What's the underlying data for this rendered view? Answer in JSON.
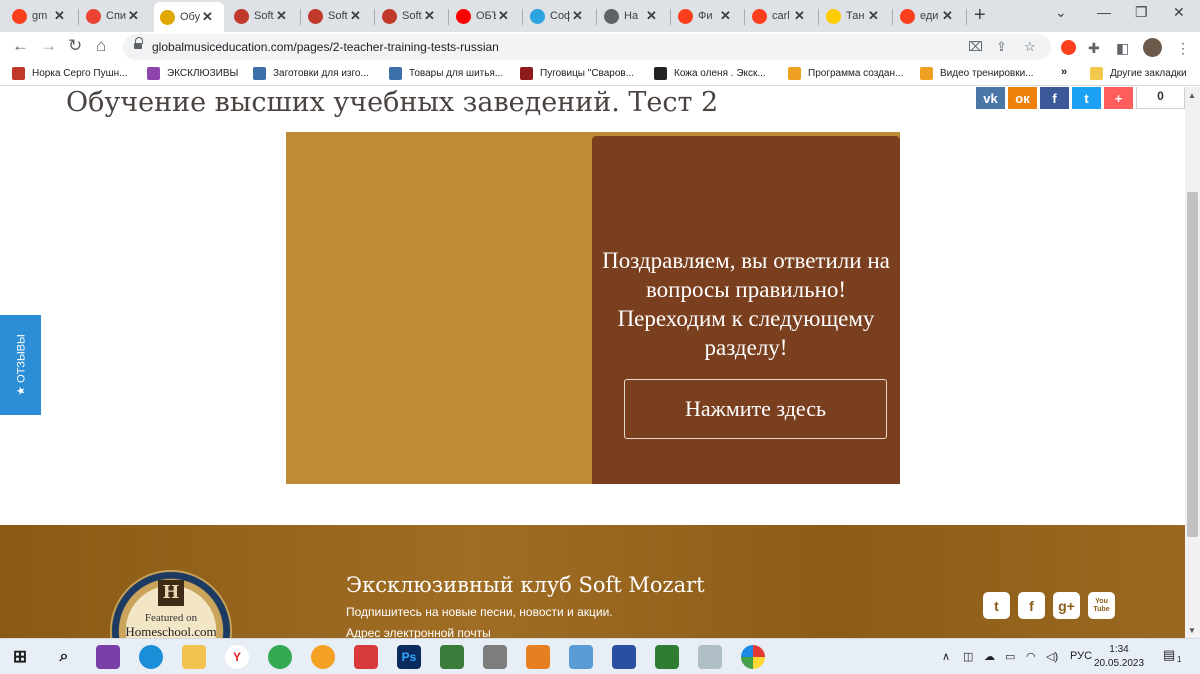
{
  "browser": {
    "tabs": [
      {
        "favicon": "yandex-icon",
        "label": "gm",
        "color": "#fc3f1d",
        "active": false
      },
      {
        "favicon": "gmail-icon",
        "label": "Спи",
        "color": "#ea4335",
        "active": false
      },
      {
        "favicon": "heart-icon",
        "label": "Обу",
        "color": "#e0a800",
        "active": true
      },
      {
        "favicon": "butterfly-icon",
        "label": "Soft",
        "color": "#c0392b",
        "active": false
      },
      {
        "favicon": "butterfly-icon",
        "label": "Soft",
        "color": "#c0392b",
        "active": false
      },
      {
        "favicon": "butterfly-icon",
        "label": "Soft",
        "color": "#c0392b",
        "active": false
      },
      {
        "favicon": "youtube-icon",
        "label": "ОБЪ",
        "color": "#ff0000",
        "active": false
      },
      {
        "favicon": "telegram-icon",
        "label": "Соф",
        "color": "#2aa3df",
        "active": false
      },
      {
        "favicon": "globe-icon",
        "label": "На",
        "color": "#5f6368",
        "active": false
      },
      {
        "favicon": "yandex-icon",
        "label": "Фи",
        "color": "#fc3f1d",
        "active": false
      },
      {
        "favicon": "yandex-icon",
        "label": "carl",
        "color": "#fc3f1d",
        "active": false
      },
      {
        "favicon": "play-icon",
        "label": "Тан",
        "color": "#ffcc00",
        "active": false
      },
      {
        "favicon": "yandex-icon",
        "label": "еди",
        "color": "#fc3f1d",
        "active": false
      }
    ],
    "tab_close": "✕",
    "new_tab": "+",
    "url": "globalmusiceducation.com/pages/2-teacher-training-tests-russian",
    "bookmarks": [
      {
        "label": "Норка Серго Пушн...",
        "icon": "color-square-icon",
        "color": "#c0392b"
      },
      {
        "label": "ЭКСКЛЮЗИВЫ",
        "icon": "butterfly-icon",
        "color": "#8e44ad"
      },
      {
        "label": "Заготовки для изго...",
        "icon": "b-letter-icon",
        "color": "#3d6fa8"
      },
      {
        "label": "Товары для шитья...",
        "icon": "b-letter-icon",
        "color": "#3d6fa8"
      },
      {
        "label": "Пуговицы \"Сваров...",
        "icon": "button-icon",
        "color": "#8e1b1b"
      },
      {
        "label": "Кожа оленя . Экск...",
        "icon": "x-logo-icon",
        "color": "#222222"
      },
      {
        "label": "Программа создан...",
        "icon": "ib-icon",
        "color": "#f0a020"
      },
      {
        "label": "Видео тренировки...",
        "icon": "ib-icon",
        "color": "#f0a020"
      }
    ],
    "bookmarks_more": "»",
    "other_bookmarks": "Другие закладки"
  },
  "page": {
    "title": "Обучение высших учебных заведений. Тест 2",
    "share_count": "0",
    "share_buttons": [
      {
        "name": "vk",
        "glyph": "vk",
        "color": "#4a76a8"
      },
      {
        "name": "odnoklassniki",
        "glyph": "ок",
        "color": "#ee8208"
      },
      {
        "name": "facebook",
        "glyph": "f",
        "color": "#3b5998"
      },
      {
        "name": "twitter",
        "glyph": "t",
        "color": "#1da1f2"
      },
      {
        "name": "plus",
        "glyph": "+",
        "color": "#ff5c5c"
      }
    ],
    "quiz_message": "Поздравляем, вы ответили на вопросы правильно! Переходим к следующему разделу!",
    "quiz_button": "Нажмите здесь",
    "feedback_tab": "★ ОТЗЫВЫ",
    "footer": {
      "badge_line1": "Featured on",
      "badge_line2": "Homeschool.com",
      "badge_logo": "H",
      "title": "Эксклюзивный клуб Soft Mozart",
      "subtitle": "Подпишитесь на новые песни, новости и акции.",
      "email_label": "Адрес электронной почты",
      "social": [
        {
          "name": "twitter",
          "glyph": "t"
        },
        {
          "name": "facebook",
          "glyph": "f"
        },
        {
          "name": "google-plus",
          "glyph": "g+"
        },
        {
          "name": "youtube",
          "glyph": "You Tube"
        }
      ]
    }
  },
  "taskbar": {
    "language": "РУС",
    "time": "1:34",
    "date": "20.05.2023",
    "notification_count": "1"
  }
}
